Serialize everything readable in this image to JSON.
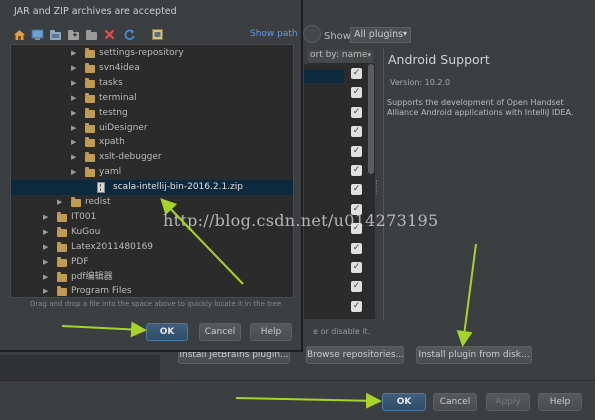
{
  "file_chooser": {
    "title": "JAR and ZIP archives are accepted",
    "show_path": "Show path",
    "tree_items": [
      {
        "label": "settings-repository",
        "type": "folder",
        "expanded": false
      },
      {
        "label": "svn4idea",
        "type": "folder",
        "expanded": false
      },
      {
        "label": "tasks",
        "type": "folder",
        "expanded": false
      },
      {
        "label": "terminal",
        "type": "folder",
        "expanded": false
      },
      {
        "label": "testng",
        "type": "folder",
        "expanded": false
      },
      {
        "label": "uiDesigner",
        "type": "folder",
        "expanded": false
      },
      {
        "label": "xpath",
        "type": "folder",
        "expanded": false
      },
      {
        "label": "xslt-debugger",
        "type": "folder",
        "expanded": false
      },
      {
        "label": "yaml",
        "type": "folder",
        "expanded": false
      },
      {
        "label": "scala-intellij-bin-2016.2.1.zip",
        "type": "zip",
        "selected": true
      },
      {
        "label": "redist",
        "type": "folder",
        "expanded": false
      },
      {
        "label": "IT001",
        "type": "folder",
        "expanded": false
      },
      {
        "label": "KuGou",
        "type": "folder",
        "expanded": false
      },
      {
        "label": "Latex2011480169",
        "type": "folder",
        "expanded": false
      },
      {
        "label": "PDF",
        "type": "folder",
        "expanded": false
      },
      {
        "label": "pdf编辑器",
        "type": "folder",
        "expanded": false
      },
      {
        "label": "Program Files",
        "type": "folder",
        "expanded": false
      }
    ],
    "hint": "Drag and drop a file into the space above to quickly locate it in the tree",
    "ok_label": "OK",
    "cancel_label": "Cancel",
    "help_label": "Help",
    "toolbar_icons": [
      "home-icon",
      "desktop-icon",
      "project-folder-icon",
      "new-folder-icon",
      "folder-icon",
      "delete-icon",
      "refresh-icon",
      "hidden-files-icon"
    ]
  },
  "plugins_dialog": {
    "show_label": "Show:",
    "show_value": "All plugins",
    "sort_label": "ort by: name",
    "plugin_checkbox_count": 13,
    "detail_title": "Android Support",
    "detail_version": "Version: 10.2.0",
    "detail_description": "Supports the development of Open Handset Alliance Android applications with IntelliJ IDEA.",
    "hint_tail": "e or disable it.",
    "install_jetbrains_label": "Install JetBrains plugin...",
    "browse_repositories_label": "Browse repositories...",
    "install_from_disk_label": "Install plugin from disk...",
    "ok_label": "OK",
    "cancel_label": "Cancel",
    "apply_label": "Apply",
    "help_label": "Help"
  },
  "watermark": "http://blog.csdn.net/u014273195",
  "colors": {
    "background": "#3c3f41",
    "tree_background": "#2b2b2b",
    "selection": "#0d293e",
    "link": "#589df6",
    "folder": "#c29b53",
    "annotation_arrow": "#a8d42a"
  }
}
